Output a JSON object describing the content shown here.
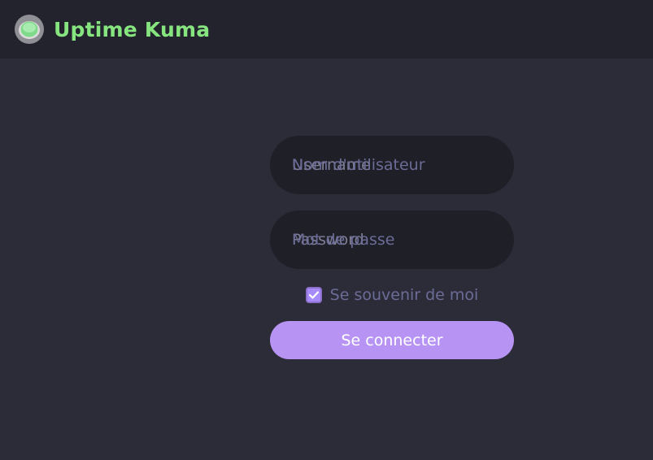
{
  "app": {
    "title": "Uptime Kuma",
    "logo_icon": "uptime-kuma-logo-icon"
  },
  "colors": {
    "brand_text": "#86e57f",
    "accent": "#b794f4",
    "checkbox_fill": "#a78bfa",
    "header_bg": "#23232e",
    "page_bg": "#2c2c38",
    "input_bg": "#1f1f27"
  },
  "login": {
    "username": {
      "placeholder": "Nom d'utilisateur",
      "floating_label": "Username",
      "value": ""
    },
    "password": {
      "placeholder": "Mot de passe",
      "floating_label": "Password",
      "value": ""
    },
    "remember_me": {
      "label": "Se souvenir de moi",
      "checked": true,
      "icon": "check-icon"
    },
    "submit_label": "Se connecter"
  }
}
